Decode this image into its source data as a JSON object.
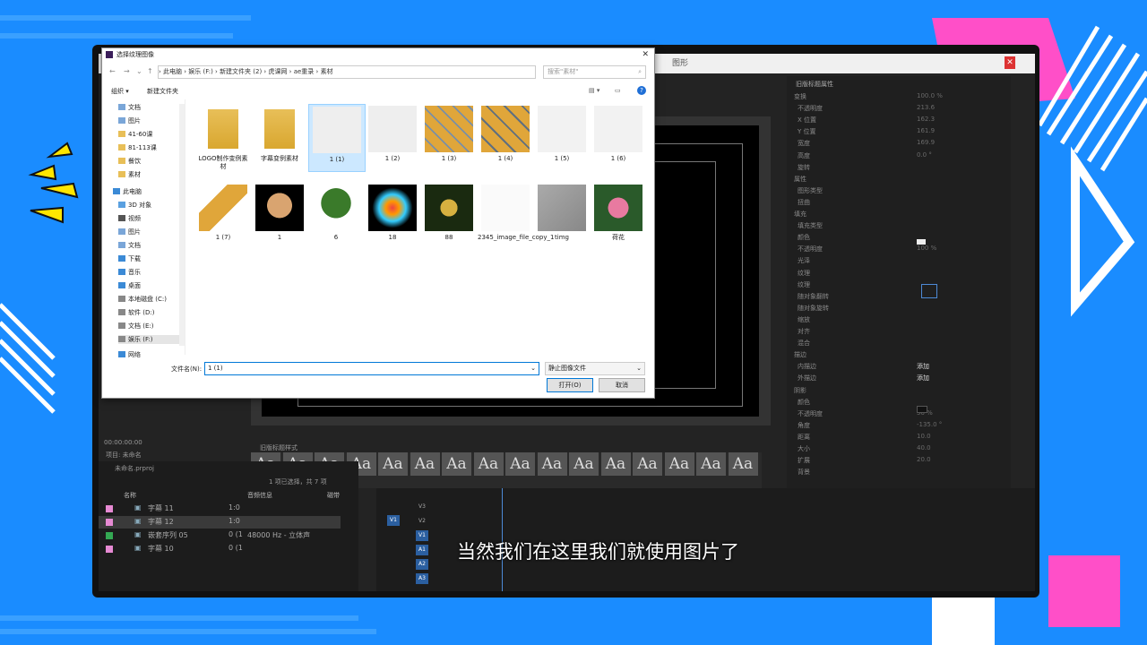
{
  "colors": {
    "bg": "#1a8cff",
    "pink": "#ff4fc8",
    "yellow": "#ffe600",
    "accent": "#0078d7"
  },
  "subtitle": "当然我们在这里我们就使用图片了",
  "dialog": {
    "title": "选择纹理图像",
    "close": "✕",
    "path": [
      "此电脑",
      "娱乐 (F:)",
      "新建文件夹 (2)",
      "虎课网",
      "ae重录",
      "素材"
    ],
    "search_placeholder": "搜索\"素材\"",
    "organize": "组织 ▾",
    "new_folder": "新建文件夹",
    "nav_items": [
      {
        "label": "文档",
        "icon": "document-icon"
      },
      {
        "label": "图片",
        "icon": "pictures-icon"
      },
      {
        "label": "41-60课",
        "icon": "folder-icon"
      },
      {
        "label": "81-113课",
        "icon": "folder-icon"
      },
      {
        "label": "餐饮",
        "icon": "folder-icon"
      },
      {
        "label": "素材",
        "icon": "folder-icon"
      },
      {
        "label": "此电脑",
        "icon": "computer-icon"
      },
      {
        "label": "3D 对象",
        "icon": "3d-objects-icon"
      },
      {
        "label": "视频",
        "icon": "video-icon"
      },
      {
        "label": "图片",
        "icon": "pictures-icon"
      },
      {
        "label": "文档",
        "icon": "document-icon"
      },
      {
        "label": "下载",
        "icon": "download-icon"
      },
      {
        "label": "音乐",
        "icon": "music-icon"
      },
      {
        "label": "桌面",
        "icon": "desktop-icon"
      },
      {
        "label": "本地磁盘 (C:)",
        "icon": "drive-icon"
      },
      {
        "label": "软件 (D:)",
        "icon": "drive-icon"
      },
      {
        "label": "文档 (E:)",
        "icon": "drive-icon"
      },
      {
        "label": "娱乐 (F:)",
        "icon": "drive-icon"
      },
      {
        "label": "网络",
        "icon": "network-icon"
      }
    ],
    "files": [
      {
        "name": "LOGO制作变例素材",
        "kind": "folder"
      },
      {
        "name": "字幕变例素材",
        "kind": "folder"
      },
      {
        "name": "1 (1)",
        "kind": "image",
        "selected": true
      },
      {
        "name": "1 (2)",
        "kind": "image"
      },
      {
        "name": "1 (3)",
        "kind": "image"
      },
      {
        "name": "1 (4)",
        "kind": "image"
      },
      {
        "name": "1 (5)",
        "kind": "image"
      },
      {
        "name": "1 (6)",
        "kind": "image"
      },
      {
        "name": "1 (7)",
        "kind": "image"
      },
      {
        "name": "1",
        "kind": "image"
      },
      {
        "name": "6",
        "kind": "image"
      },
      {
        "name": "18",
        "kind": "image"
      },
      {
        "name": "88",
        "kind": "image"
      },
      {
        "name": "2345_image_file_copy_1",
        "kind": "image"
      },
      {
        "name": "timg",
        "kind": "image"
      },
      {
        "name": "荷花",
        "kind": "video"
      }
    ],
    "filename_label": "文件名(N):",
    "filename_value": "1 (1)",
    "filetype": "静止图像文件",
    "open_btn": "打开(O)",
    "cancel_btn": "取消"
  },
  "premiere": {
    "menu": "图形",
    "props": {
      "header": "旧版标题属性",
      "rows": [
        "变换",
        "不透明度",
        "X 位置",
        "Y 位置",
        "宽度",
        "高度",
        "旋转",
        "属性",
        "图形类型",
        "扭曲",
        "填充",
        "填充类型",
        "颜色",
        "不透明度",
        "光泽",
        "纹理",
        "纹理",
        "随对象翻转",
        "随对象旋转",
        "缩放",
        "对齐",
        "混合",
        "描边",
        "内描边",
        "外描边",
        "阴影",
        "颜色",
        "不透明度",
        "角度",
        "距离",
        "大小",
        "扩展",
        "背景"
      ],
      "values": [
        "100.0 %",
        "213.6",
        "162.3",
        "161.9",
        "169.9",
        "0.0 °",
        "",
        "",
        "",
        "",
        "",
        "",
        "",
        "100 %",
        "",
        "",
        "",
        "",
        "",
        "",
        "",
        "",
        "",
        "添加",
        "添加",
        "",
        "",
        "50 %",
        "-135.0 °",
        "10.0",
        "40.0",
        "20.0",
        ""
      ]
    },
    "styles_header": "旧版标题样式",
    "styles_labels": [
      "Aa",
      "Aa",
      "Aa",
      "Aa",
      "Aa",
      "Aa",
      "Aa",
      "Aa",
      "Aa",
      "Aa",
      "Aa",
      "Aa",
      "Aa",
      "Aa",
      "Aa",
      "Aa"
    ],
    "project": {
      "tab": "项目: 未命名",
      "file": "未命名.prproj",
      "status": "1 项已选择，共 7 项",
      "col_name": "名称",
      "col_audio": "音频信息",
      "col_tape": "磁带",
      "rows": [
        {
          "name": "字幕 11",
          "fps": "1:0",
          "audio": "",
          "color": "#e68ad3"
        },
        {
          "name": "字幕 12",
          "fps": "1:0",
          "audio": "",
          "color": "#e68ad3"
        },
        {
          "name": "嵌套序列 05",
          "fps": "0 (1",
          "audio": "48000 Hz - 立体声",
          "color": "#34a853"
        },
        {
          "name": "字幕 10",
          "fps": "0 (1",
          "audio": "",
          "color": "#e68ad3"
        }
      ]
    },
    "timecode": "00:00:00:00",
    "tracks": [
      "V3",
      "V2",
      "V1",
      "A1",
      "A2",
      "A3"
    ],
    "source_v1": "V1"
  }
}
